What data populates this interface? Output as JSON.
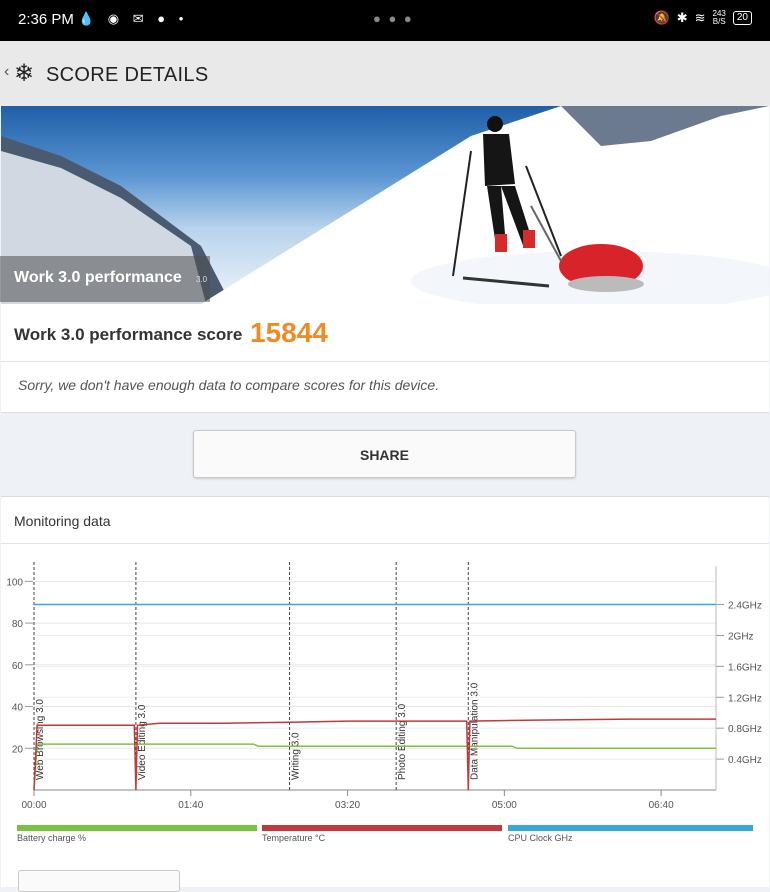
{
  "status_bar": {
    "time": "2:36 PM",
    "notification_icons": "💧 ◉ ✉ ● •",
    "net_speed_value": "243",
    "net_speed_unit": "B/S",
    "battery": "20"
  },
  "app_bar": {
    "title": "SCORE DETAILS",
    "icon": "snowflake-icon"
  },
  "hero": {
    "title": "Work 3.0 performance",
    "version": "3.0"
  },
  "score": {
    "label": "Work 3.0 performance score",
    "value": "15844",
    "note": "Sorry, we don't have enough data to compare scores for this device."
  },
  "share": {
    "label": "SHARE"
  },
  "monitoring": {
    "title": "Monitoring data",
    "legend": [
      {
        "label": "Battery charge %",
        "color": "#7cc242"
      },
      {
        "label": "Temperature °C",
        "color": "#c0393b"
      },
      {
        "label": "CPU Clock GHz",
        "color": "#3aa7d9"
      }
    ]
  },
  "chart_data": {
    "type": "line",
    "x_unit": "seconds",
    "x_ticks": [
      "00:00",
      "01:40",
      "03:20",
      "05:00",
      "06:40"
    ],
    "x_range": [
      0,
      435
    ],
    "y_left_ticks": [
      "100",
      "80",
      "60",
      "40",
      "20"
    ],
    "y_left_range": [
      0,
      100
    ],
    "y_right_ticks": [
      "2.4GHz",
      "2GHz",
      "1.6GHz",
      "1.2GHz",
      "0.8GHz",
      "0.4GHz"
    ],
    "y_right_range": [
      0,
      2.7
    ],
    "markers": [
      {
        "label": "Web Browsing 3.0",
        "x": 0
      },
      {
        "label": "Video Editing 3.0",
        "x": 65
      },
      {
        "label": "Writing 3.0",
        "x": 163
      },
      {
        "label": "Photo Editing 3.0",
        "x": 231
      },
      {
        "label": "Data Manipulation 3.0",
        "x": 277
      }
    ],
    "series": [
      {
        "name": "Battery charge %",
        "axis": "left",
        "color": "#7cc242",
        "x": [
          0,
          2,
          65,
          140,
          143,
          170,
          235,
          305,
          308,
          435
        ],
        "y": [
          0,
          22,
          22,
          22,
          21,
          21,
          21,
          21,
          20,
          20
        ]
      },
      {
        "name": "Temperature °C",
        "axis": "left",
        "color": "#c0393b",
        "x": [
          0,
          2,
          64,
          65,
          66,
          80,
          120,
          163,
          200,
          231,
          276,
          277,
          278,
          320,
          380,
          435
        ],
        "y": [
          0,
          31,
          31,
          0,
          31,
          32,
          32,
          32.5,
          33,
          33,
          33,
          0,
          33,
          33.5,
          34,
          34
        ]
      },
      {
        "name": "CPU Clock GHz",
        "axis": "right",
        "color": "#3aa7d9",
        "x": [
          0,
          435
        ],
        "y": [
          2.4,
          2.4
        ]
      }
    ],
    "grid": true
  }
}
